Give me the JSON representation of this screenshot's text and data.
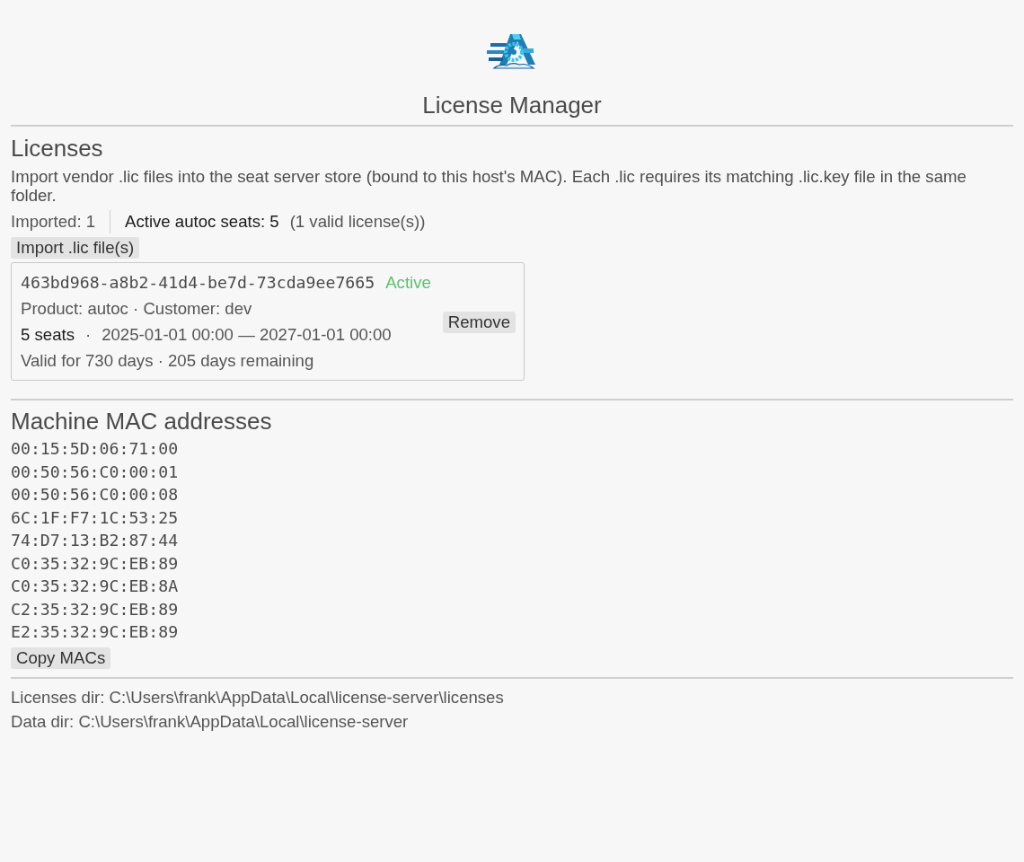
{
  "app": {
    "title": "License Manager"
  },
  "licenses_section": {
    "heading": "Licenses",
    "description": "Import vendor .lic files into the seat server store (bound to this host's MAC). Each .lic requires its matching .lic.key file in the same folder.",
    "stats": {
      "imported": "Imported: 1",
      "active_seats": "Active autoc seats: 5",
      "valid_count": "(1 valid license(s))"
    },
    "import_button": "Import .lic file(s)",
    "license_cards": [
      {
        "id": "463bd968-a8b2-41d4-be7d-73cda9ee7665",
        "status": {
          "label": "Active",
          "kind": "active"
        },
        "product_line": "Product: autoc · Customer: dev",
        "seats": "5 seats",
        "separator": "·",
        "period": "2025-01-01 00:00 — 2027-01-01 00:00",
        "validity": "Valid for 730 days · 205 days remaining",
        "remove_button": "Remove"
      }
    ]
  },
  "mac_section": {
    "heading": "Machine MAC addresses",
    "addresses": [
      "00:15:5D:06:71:00",
      "00:50:56:C0:00:01",
      "00:50:56:C0:00:08",
      "6C:1F:F7:1C:53:25",
      "74:D7:13:B2:87:44",
      "C0:35:32:9C:EB:89",
      "C0:35:32:9C:EB:8A",
      "C2:35:32:9C:EB:89",
      "E2:35:32:9C:EB:89"
    ],
    "copy_button": "Copy MACs"
  },
  "footer": {
    "lines": [
      "Licenses dir: C:\\Users\\frank\\AppData\\Local\\license-server\\licenses",
      "Data dir: C:\\Users\\frank\\AppData\\Local\\license-server"
    ]
  }
}
